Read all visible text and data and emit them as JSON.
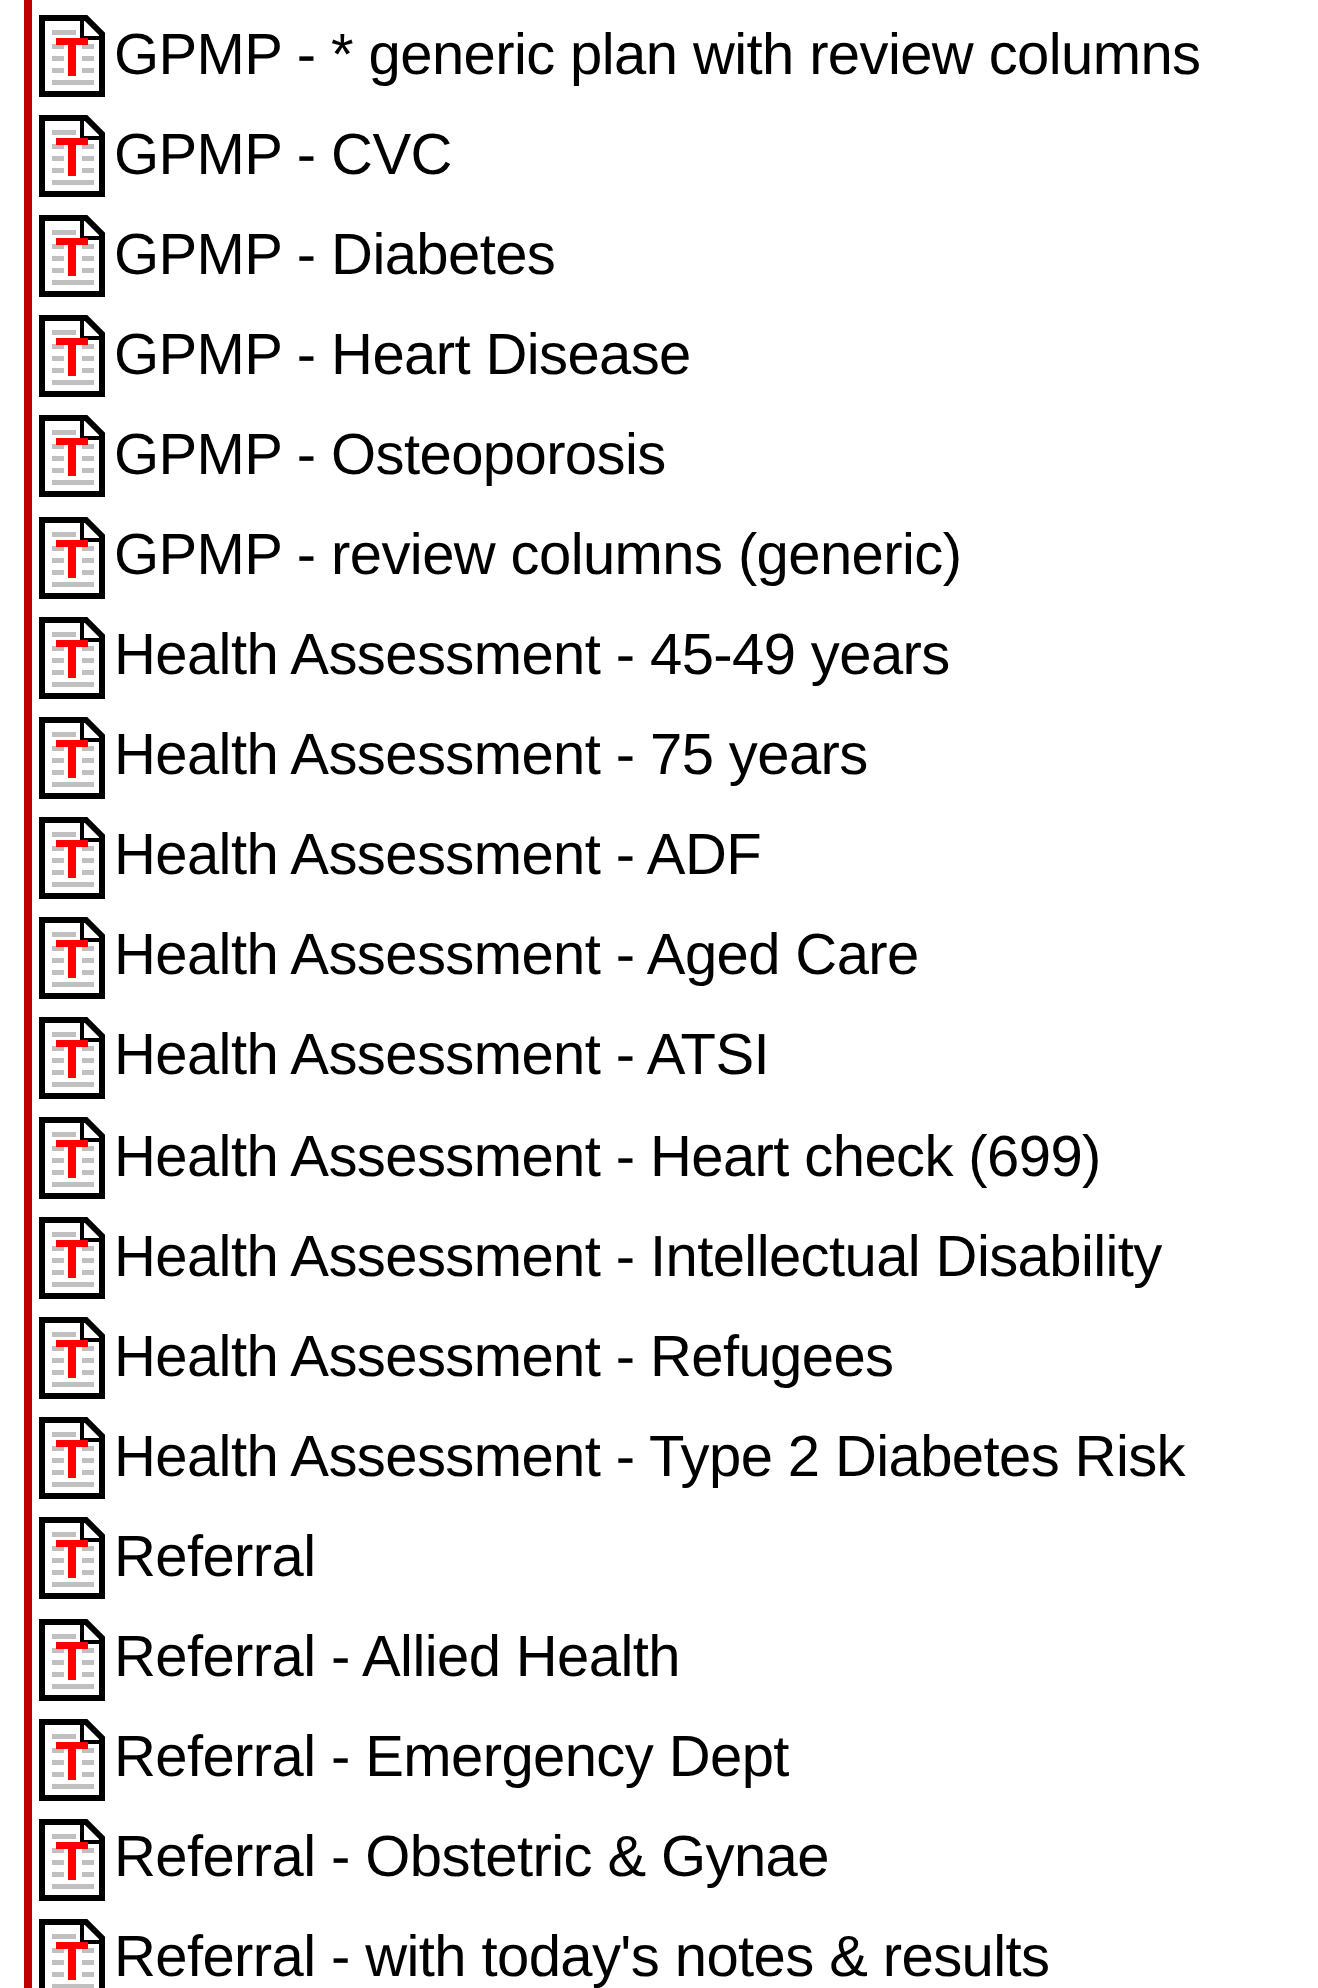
{
  "items": [
    {
      "label": "GPMP - * generic plan with review columns"
    },
    {
      "label": "GPMP - CVC"
    },
    {
      "label": "GPMP - Diabetes"
    },
    {
      "label": "GPMP - Heart Disease"
    },
    {
      "label": "GPMP - Osteoporosis"
    },
    {
      "label": "GPMP - review columns (generic)"
    },
    {
      "label": "Health Assessment - 45-49 years"
    },
    {
      "label": "Health Assessment - 75 years"
    },
    {
      "label": "Health Assessment - ADF"
    },
    {
      "label": "Health Assessment - Aged Care"
    },
    {
      "label": "Health Assessment - ATSI"
    },
    {
      "label": "Health Assessment - Heart check (699)"
    },
    {
      "label": "Health Assessment - Intellectual Disability"
    },
    {
      "label": "Health Assessment - Refugees"
    },
    {
      "label": "Health Assessment - Type 2 Diabetes Risk"
    },
    {
      "label": "Referral"
    },
    {
      "label": "Referral - Allied Health"
    },
    {
      "label": "Referral - Emergency Dept"
    },
    {
      "label": "Referral - Obstetric & Gynae"
    },
    {
      "label": "Referral - with today's notes & results"
    }
  ]
}
